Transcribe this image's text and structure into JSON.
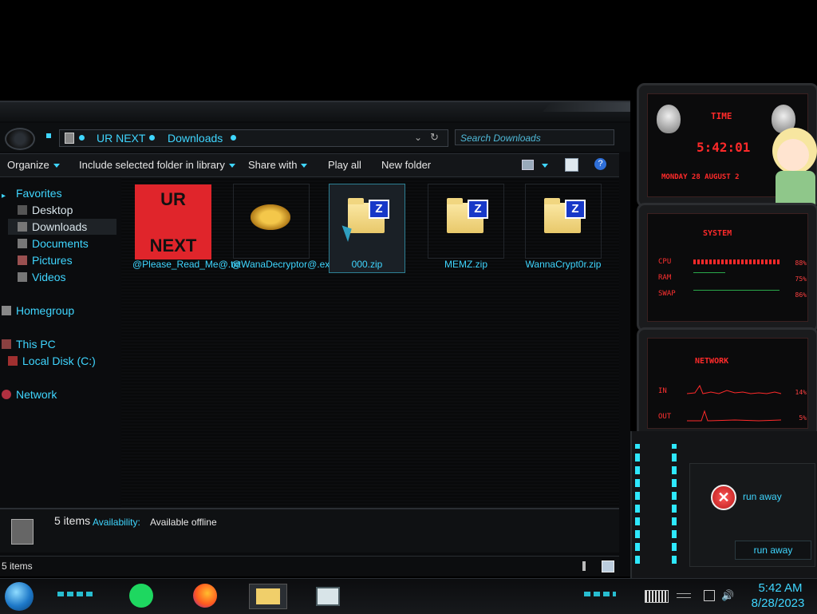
{
  "explorer": {
    "breadcrumb": [
      "UR NEXT",
      "Downloads"
    ],
    "search_placeholder": "Search Downloads",
    "toolbar": {
      "organize": "Organize",
      "include_library": "Include selected folder in library",
      "share_with": "Share with",
      "play_all": "Play all",
      "new_folder": "New folder"
    },
    "nav": {
      "favorites": "Favorites",
      "desktop": "Desktop",
      "downloads": "Downloads",
      "documents": "Documents",
      "pictures": "Pictures",
      "videos": "Videos",
      "homegroup": "Homegroup",
      "this_pc": "This PC",
      "local_disk": "Local Disk (C:)",
      "network": "Network"
    },
    "files": [
      {
        "name": "@Please_Read_Me@.txt",
        "thumb_line1": "UR",
        "thumb_line2": "NEXT"
      },
      {
        "name": "@WanaDecryptor@.exe"
      },
      {
        "name": "000.zip",
        "zip_letter": "Z"
      },
      {
        "name": "MEMZ.zip",
        "zip_letter": "Z"
      },
      {
        "name": "WannaCrypt0r.zip",
        "zip_letter": "Z"
      }
    ],
    "details": {
      "count": "5 items",
      "availability_label": "Availability:",
      "availability_value": "Available offline"
    },
    "status": "5 items"
  },
  "gadgets": {
    "time": {
      "title": "TIME",
      "clock": "5:42:01",
      "date": "MONDAY 28 AUGUST 2"
    },
    "system": {
      "title": "SYSTEM",
      "cpu": "CPU",
      "ram": "RAM",
      "swap": "SWAP",
      "cpu_pct": "88%",
      "ram_pct": "75%",
      "swap_pct": "86%"
    },
    "network": {
      "title": "NETWORK",
      "in": "IN",
      "out": "OUT",
      "in_pct": "14%",
      "out_pct": "5%"
    }
  },
  "dialog": {
    "message": "run away",
    "button": "run away"
  },
  "taskbar": {
    "time": "5:42 AM",
    "date": "8/28/2023"
  },
  "colors": {
    "accent": "#3fd6ff",
    "alien_red": "#ff2a2a",
    "glow": "#2ee8ff"
  }
}
